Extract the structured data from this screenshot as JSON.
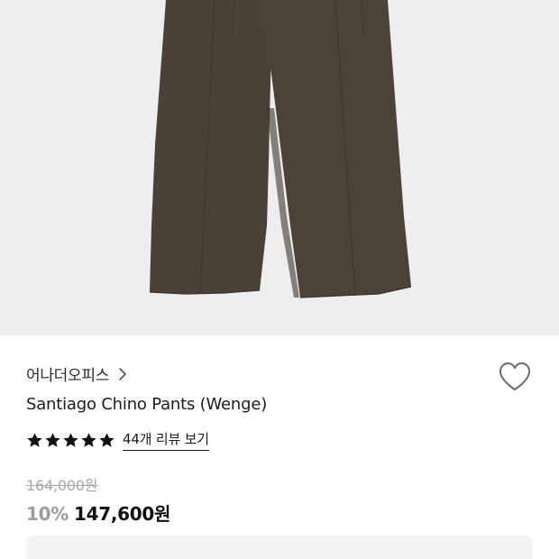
{
  "product": {
    "brand": "어나더오피스",
    "title": "Santiago Chino Pants (Wenge)",
    "rating": 5,
    "rating_max": 5,
    "review_link": "44개 리뷰 보기",
    "original_price": "164,000원",
    "discount": "10%",
    "sale_price": "147,600원"
  },
  "colors": {
    "image_background": "#eeeeee",
    "pants": "#4a4138",
    "star": "#111111",
    "muted_text": "#a9a9a9"
  },
  "icons": {
    "brand_link": "chevron-right-icon",
    "wishlist": "heart-outline-icon",
    "rating": "star-filled-icon"
  }
}
